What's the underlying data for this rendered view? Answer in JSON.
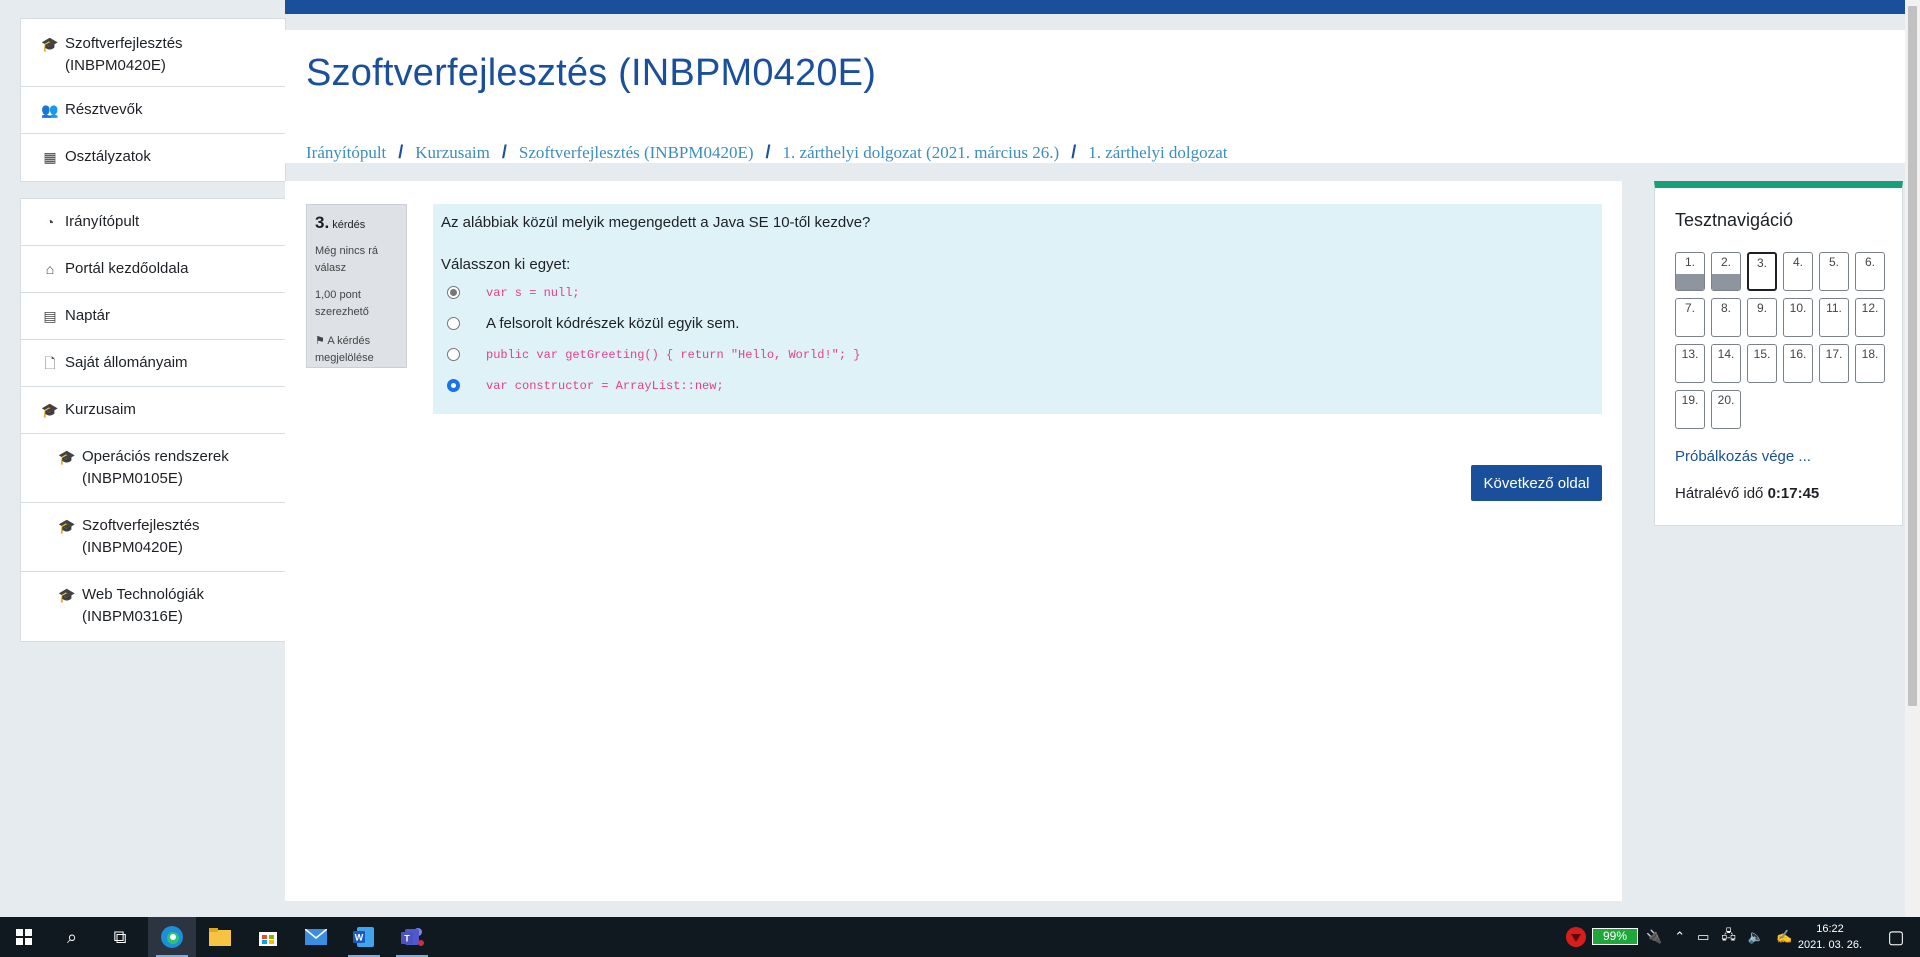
{
  "drawer": {
    "block1": [
      {
        "label": "Szoftverfejlesztés (INBPM0420E)",
        "icon": "graduation-cap-icon"
      },
      {
        "label": "Résztvevők",
        "icon": "users-icon"
      },
      {
        "label": "Osztályzatok",
        "icon": "table-icon"
      }
    ],
    "block2": [
      {
        "label": "Irányítópult",
        "icon": "dashboard-icon"
      },
      {
        "label": "Portál kezdőoldala",
        "icon": "home-icon"
      },
      {
        "label": "Naptár",
        "icon": "calendar-icon"
      },
      {
        "label": "Saját állományaim",
        "icon": "file-icon"
      },
      {
        "label": "Kurzusaim",
        "icon": "graduation-cap-icon"
      },
      {
        "label": "Operációs rendszerek (INBPM0105E)",
        "icon": "graduation-cap-icon"
      },
      {
        "label": "Szoftverfejlesztés (INBPM0420E)",
        "icon": "graduation-cap-icon"
      },
      {
        "label": "Web Technológiák (INBPM0316E)",
        "icon": "graduation-cap-icon"
      }
    ]
  },
  "header": {
    "title": "Szoftverfejlesztés (INBPM0420E)",
    "breadcrumb": [
      "Irányítópult",
      "Kurzusaim",
      "Szoftverfejlesztés (INBPM0420E)",
      "1. zárthelyi dolgozat (2021. március 26.)",
      "1. zárthelyi dolgozat"
    ]
  },
  "question": {
    "number": "3.",
    "number_label": "kérdés",
    "state": "Még nincs rá válasz",
    "points": "1,00 pont szerezhető",
    "flag_label": "A kérdés megjelölése",
    "text": "Az alábbiak közül melyik megengedett a Java SE 10-től kezdve?",
    "prompt": "Válasszon ki egyet:",
    "answers": [
      "var s = null;",
      "A felsorolt kódrészek közül egyik sem.",
      "public var getGreeting() { return \"Hello, World!\"; }",
      "var constructor = ArrayList::new;"
    ]
  },
  "next_button": "Következő oldal",
  "quiz_nav": {
    "title": "Tesztnavigáció",
    "buttons": [
      "1.",
      "2.",
      "3.",
      "4.",
      "5.",
      "6.",
      "7.",
      "8.",
      "9.",
      "10.",
      "11.",
      "12.",
      "13.",
      "14.",
      "15.",
      "16.",
      "17.",
      "18.",
      "19.",
      "20."
    ],
    "finish_link": "Próbálkozás vége ...",
    "timer_label": "Hátralévő idő",
    "timer_value": "0:17:45"
  },
  "taskbar": {
    "battery": "99%",
    "time": "16:22",
    "date": "2021. 03. 26."
  },
  "colors": {
    "brand": "#1a4f9c",
    "nav_accent": "#17a07a",
    "question_bg": "#def2f8"
  }
}
